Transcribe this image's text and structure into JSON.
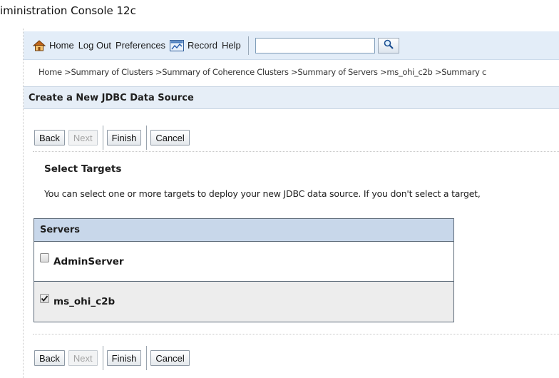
{
  "app": {
    "title": "iministration Console 12c"
  },
  "toolbar": {
    "items": [
      {
        "label": "Home",
        "icon": "home-icon"
      },
      {
        "label": "Log Out"
      },
      {
        "label": "Preferences"
      },
      {
        "label": "Record",
        "icon": "record-icon"
      },
      {
        "label": "Help"
      }
    ],
    "search": {
      "value": "",
      "placeholder": ""
    },
    "search_button_icon": "search-icon"
  },
  "breadcrumb": {
    "items": [
      "Home",
      "Summary of Clusters",
      "Summary of Coherence Clusters",
      "Summary of Servers",
      "ms_ohi_c2b",
      "Summary c"
    ],
    "separator": ">"
  },
  "page": {
    "title": "Create a New JDBC Data Source"
  },
  "buttons": {
    "back": "Back",
    "next": "Next",
    "finish": "Finish",
    "cancel": "Cancel"
  },
  "section": {
    "title": "Select Targets",
    "instructions": "You can select one or more targets to deploy your new JDBC data source. If you don't select a target,"
  },
  "targets_table": {
    "header": "Servers",
    "rows": [
      {
        "name": "AdminServer",
        "checked": false
      },
      {
        "name": "ms_ohi_c2b",
        "checked": true
      }
    ]
  },
  "colors": {
    "toolbar_bg": "#e3edf8",
    "panel_header_bg": "#e6eef7",
    "table_header_bg": "#c8d7ea",
    "checked_row_bg": "#ededed"
  }
}
